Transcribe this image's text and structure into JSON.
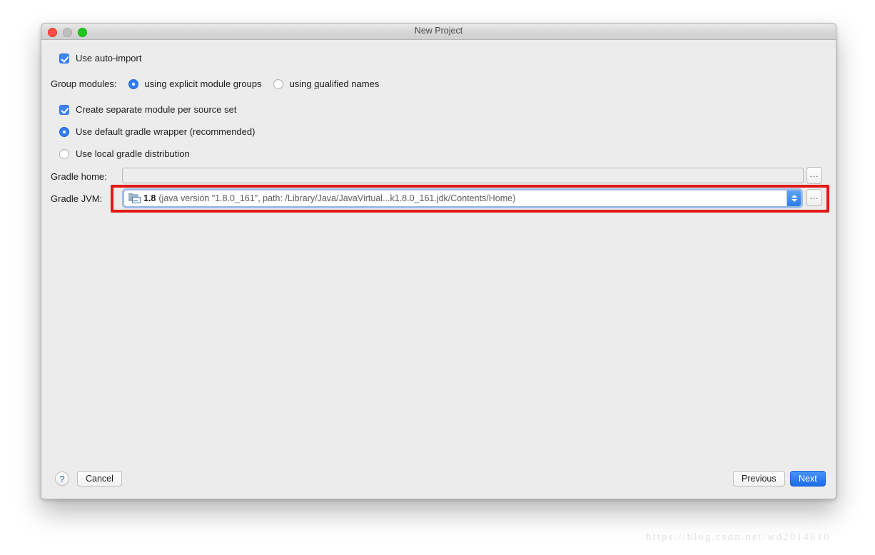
{
  "window": {
    "title": "New Project",
    "traffic_lights": [
      "close-button",
      "minimize-button",
      "zoom-button"
    ]
  },
  "form": {
    "auto_import": {
      "label": "Use auto-import",
      "checked": true
    },
    "group_modules": {
      "label": "Group modules:",
      "options": [
        {
          "label_pre": "using explicit module ",
          "mnemonic": "g",
          "label_post": "roups",
          "selected": true
        },
        {
          "label_pre": "using ",
          "mnemonic": "q",
          "label_post": "ualified names",
          "selected": false
        }
      ]
    },
    "separate_module": {
      "label": "Create separate module per source set",
      "checked": true
    },
    "gradle_wrapper": {
      "label": "Use default gradle wrapper (recommended)",
      "selected": true
    },
    "local_distribution": {
      "label": "Use local gradle distribution",
      "selected": false
    },
    "gradle_home": {
      "label": "Gradle home:",
      "value": "",
      "placeholder": "",
      "browse_label": "..."
    },
    "gradle_jvm": {
      "label": "Gradle JVM:",
      "version": "1.8",
      "details": "(java version \"1.8.0_161\", path: /Library/Java/JavaVirtual...k1.8.0_161.jdk/Contents/Home)",
      "browse_label": "...",
      "icon": "jdk-icon"
    }
  },
  "footer": {
    "help_label": "?",
    "cancel_label": "Cancel",
    "previous_label": "Previous",
    "next_label": "Next"
  },
  "annotation": {
    "highlight_color": "#e01b16"
  },
  "watermark": {
    "text": "https://blog.csdn.net/wd2014610"
  }
}
